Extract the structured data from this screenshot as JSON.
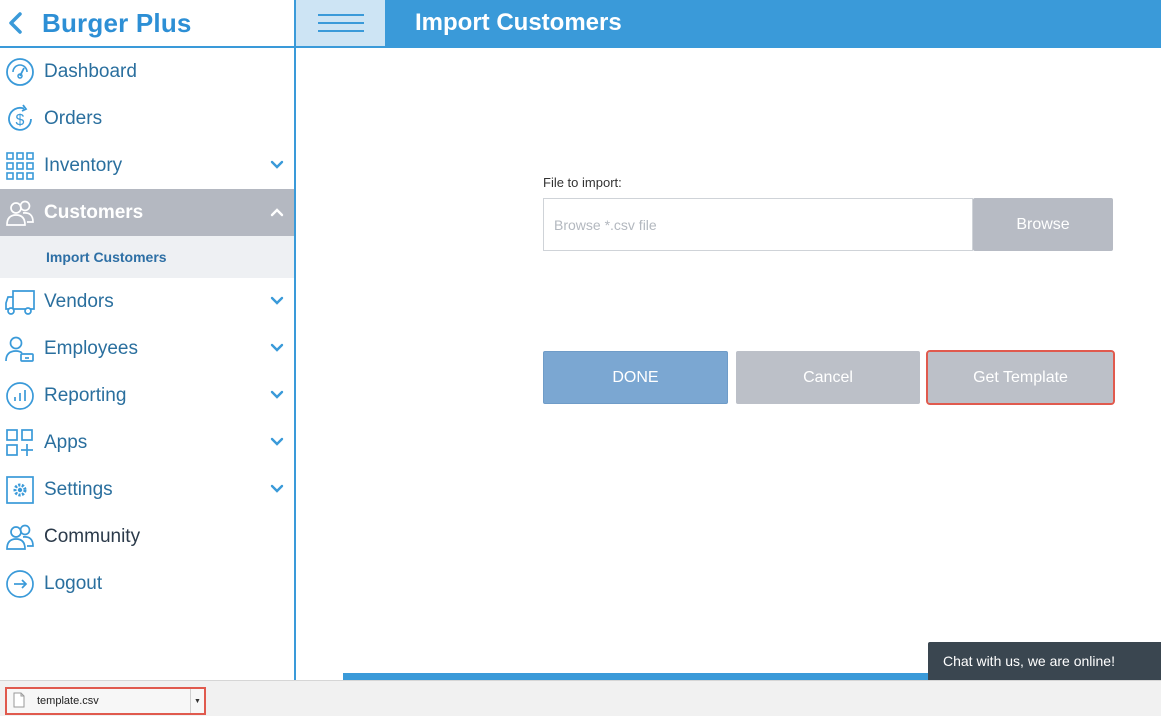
{
  "brand": {
    "title": "Burger Plus"
  },
  "sidebar": {
    "items": [
      {
        "label": "Dashboard",
        "icon": "dashboard-gauge-icon",
        "expandable": false
      },
      {
        "label": "Orders",
        "icon": "dollar-refresh-icon",
        "expandable": false
      },
      {
        "label": "Inventory",
        "icon": "grid-icon",
        "expandable": true
      },
      {
        "label": "Customers",
        "icon": "users-icon",
        "expandable": true,
        "active": true
      },
      {
        "label": "Vendors",
        "icon": "truck-icon",
        "expandable": true
      },
      {
        "label": "Employees",
        "icon": "employee-icon",
        "expandable": true
      },
      {
        "label": "Reporting",
        "icon": "chart-circle-icon",
        "expandable": true
      },
      {
        "label": "Apps",
        "icon": "apps-icon",
        "expandable": true
      },
      {
        "label": "Settings",
        "icon": "gear-icon",
        "expandable": true
      },
      {
        "label": "Community",
        "icon": "community-icon",
        "expandable": false
      },
      {
        "label": "Logout",
        "icon": "logout-icon",
        "expandable": false
      }
    ],
    "sub_item": "Import Customers"
  },
  "header": {
    "title": "Import Customers"
  },
  "form": {
    "file_label": "File to import:",
    "file_placeholder": "Browse *.csv file",
    "browse_label": "Browse",
    "done_label": "DONE",
    "cancel_label": "Cancel",
    "template_label": "Get Template"
  },
  "chat": {
    "label": "Chat with us, we are online!"
  },
  "downloads": {
    "file_name": "template.csv"
  },
  "colors": {
    "accent": "#3a9ad9",
    "brand_text": "#2d8fd5",
    "active_nav": "#b4b8c1",
    "done_button": "#7ba7d2",
    "gray_button": "#bcc0c8",
    "highlight": "#e05a4e",
    "chat_bg": "#3a4650"
  }
}
